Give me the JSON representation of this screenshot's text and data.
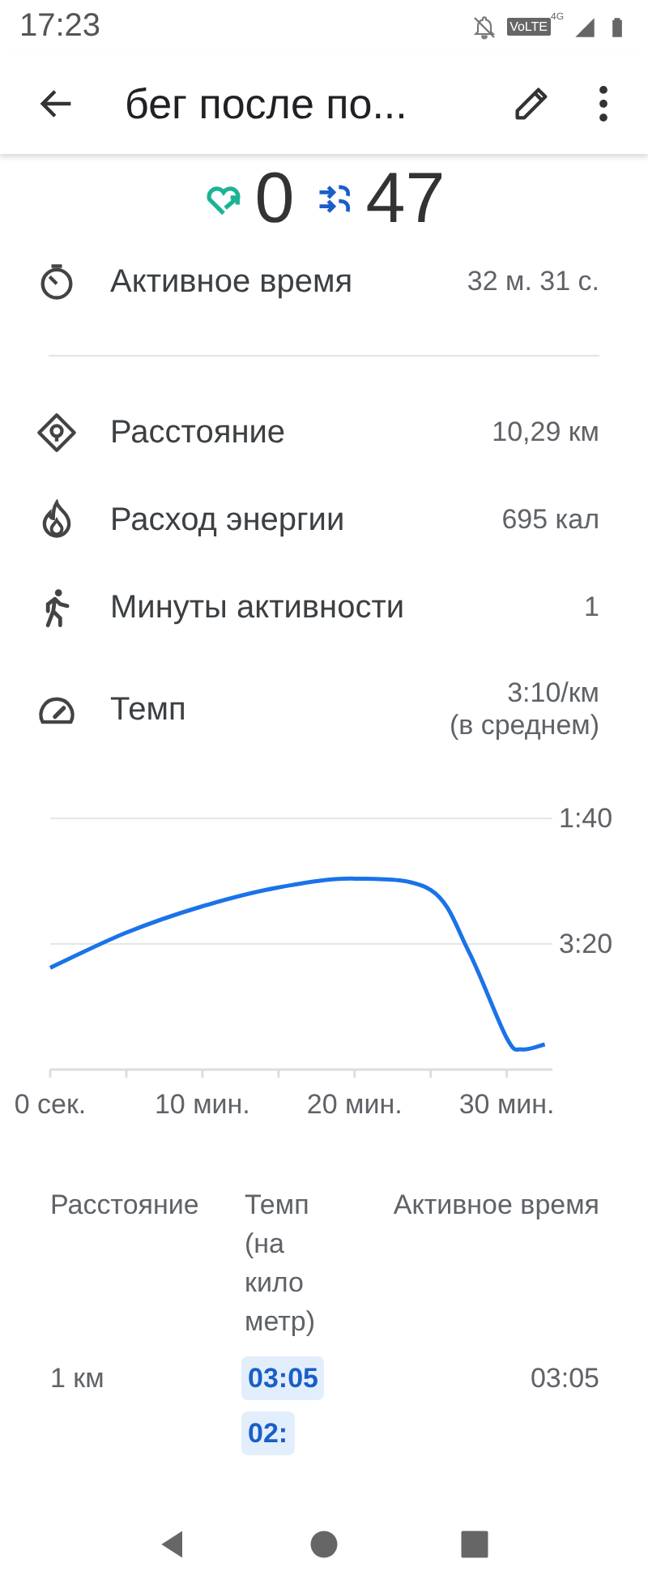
{
  "status_bar": {
    "time": "17:23",
    "network_label": "VoLTE",
    "network_type": "4G"
  },
  "header": {
    "title": "бег после по..."
  },
  "summary": [
    {
      "kind": "heart",
      "value": "0"
    },
    {
      "kind": "steps",
      "value": "47"
    }
  ],
  "stats": [
    {
      "kind": "timer",
      "label": "Активное время",
      "value": "32 м. 31 с."
    },
    {
      "kind": "divider"
    },
    {
      "kind": "distance",
      "label": "Расстояние",
      "value": "10,29 км"
    },
    {
      "kind": "energy",
      "label": "Расход энергии",
      "value": "695 кал"
    },
    {
      "kind": "walk",
      "label": "Минуты активности",
      "value": "1"
    },
    {
      "kind": "pace",
      "label": "Темп",
      "value": "3:10/км",
      "note": "(в среднем)"
    }
  ],
  "pace_chart": {
    "chart_data": {
      "type": "line",
      "x": [
        0,
        5,
        10,
        15,
        20,
        25,
        27.5,
        30,
        31,
        32.5
      ],
      "series": [
        {
          "color": "#1a73e8",
          "values": [
            219,
            191,
            170,
            155,
            148,
            157,
            206,
            275,
            284,
            280
          ]
        }
      ],
      "xlim": [
        0,
        33
      ],
      "ylim": [
        300,
        100
      ],
      "xticks": [
        {
          "value": 0,
          "label": "0 сек."
        },
        {
          "value": 10,
          "label": "10 мин."
        },
        {
          "value": 20,
          "label": "20 мин."
        },
        {
          "value": 30,
          "label": "30 мин."
        }
      ],
      "yticks": [
        {
          "value": 100,
          "label": "1:40"
        },
        {
          "value": 200,
          "label": "3:20"
        }
      ]
    }
  },
  "splits": {
    "columns": [
      "Расстояние",
      "Темп (на километр)",
      "Активное время"
    ],
    "rows": [
      {
        "distance": "1 км",
        "pace": "03:05",
        "time": "03:05"
      },
      {
        "pace": "02:"
      }
    ]
  }
}
